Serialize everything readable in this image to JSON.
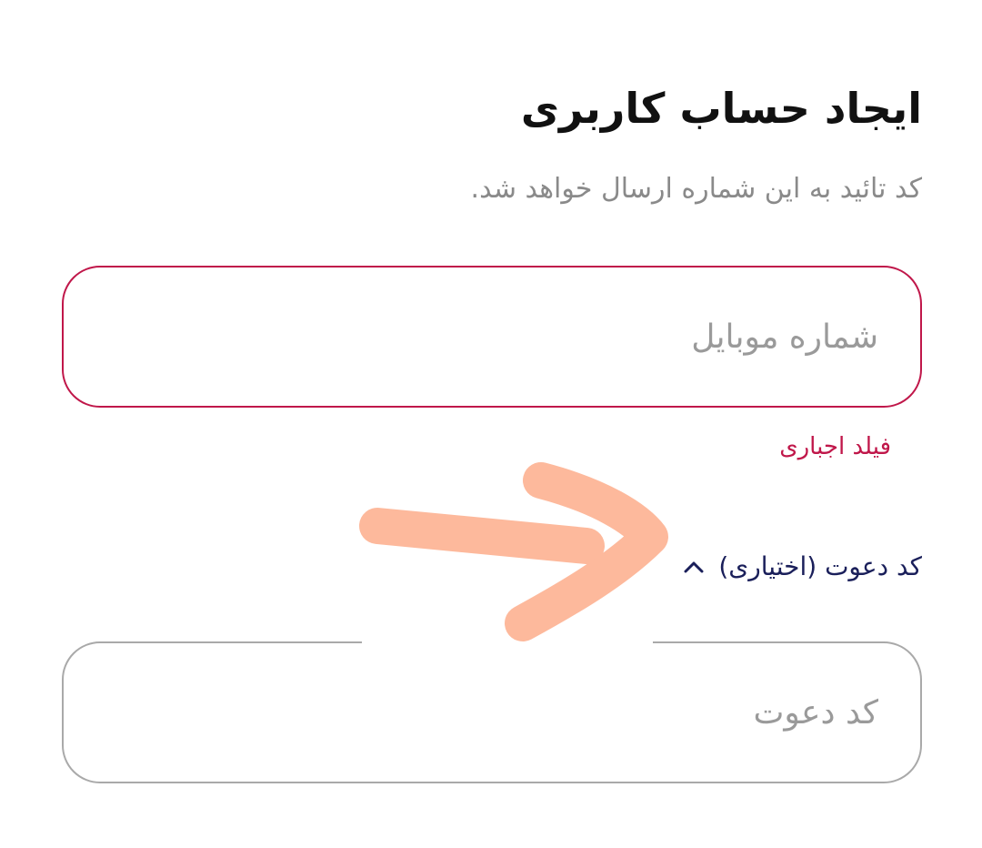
{
  "header": {
    "title": "ایجاد حساب کاربری",
    "subtitle": "کد تائید به این شماره ارسال خواهد شد."
  },
  "mobile": {
    "placeholder": "شماره موبایل",
    "value": "",
    "error": "فیلد اجباری"
  },
  "invite": {
    "toggle_label": "کد دعوت (اختیاری)",
    "toggle_icon": "chevron-up-icon",
    "placeholder": "کد دعوت",
    "value": ""
  },
  "colors": {
    "error": "#c0174a",
    "link": "#1a1f5a",
    "annotation": "#fdb99c"
  }
}
